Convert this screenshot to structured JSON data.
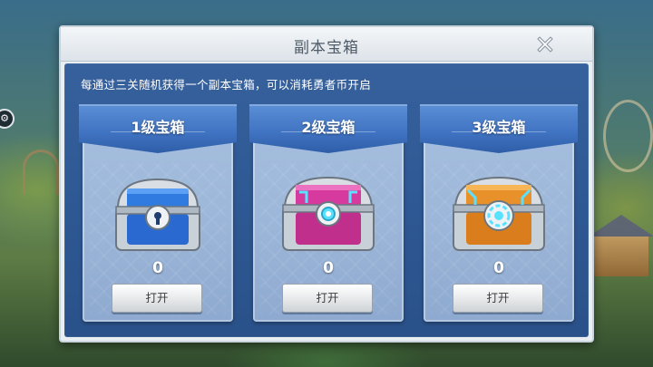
{
  "dialog": {
    "title": "副本宝箱",
    "close_icon": "close-icon",
    "description": "每通过三关随机获得一个副本宝箱，可以消耗勇者币开启"
  },
  "chests": [
    {
      "title": "1级宝箱",
      "count": "0",
      "button_label": "打开",
      "icon": "blue-chest-icon",
      "accent": "#2f7be0"
    },
    {
      "title": "2级宝箱",
      "count": "0",
      "button_label": "打开",
      "icon": "pink-chest-icon",
      "accent": "#d63a9e"
    },
    {
      "title": "3级宝箱",
      "count": "0",
      "button_label": "打开",
      "icon": "orange-chest-icon",
      "accent": "#e8902a"
    }
  ],
  "colors": {
    "panel_blue": "#2e5893",
    "card_blue": "#9cb6d9",
    "banner_blue": "#3f72c1",
    "title_text": "#4f5b67"
  }
}
